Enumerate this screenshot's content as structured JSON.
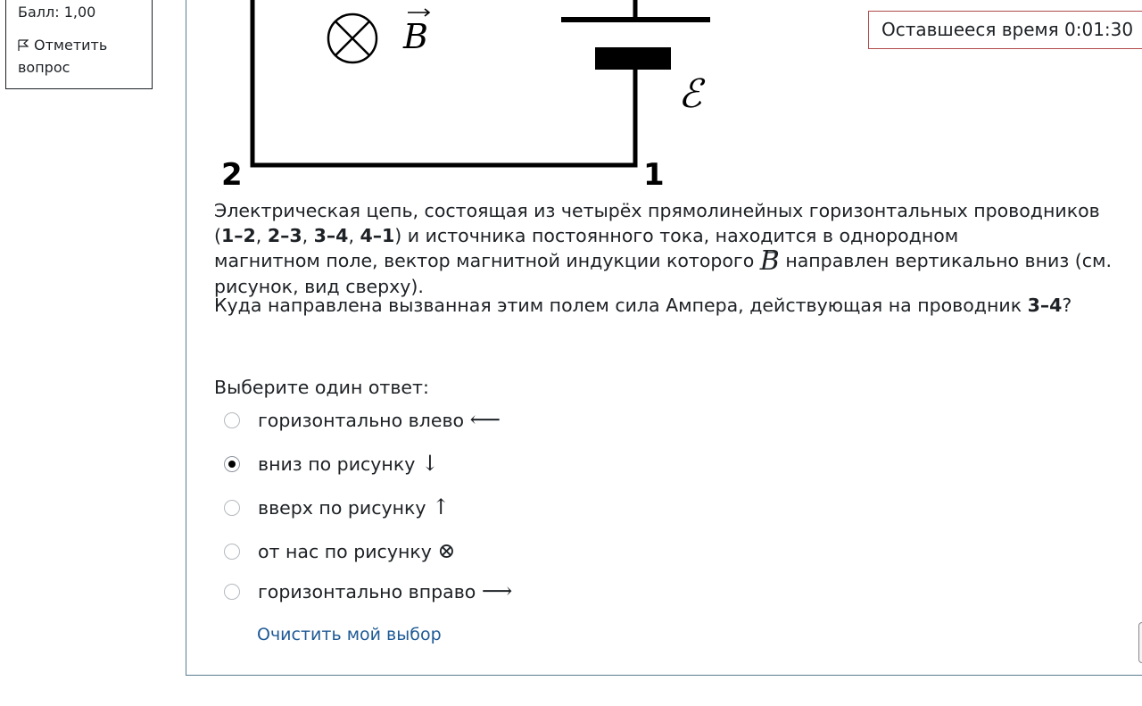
{
  "sidebar": {
    "score": "Балл: 1,00",
    "flag_label": "Отметить вопрос"
  },
  "timer": {
    "label": "Оставшееся время",
    "value": "0:01:30"
  },
  "figure": {
    "field_symbol": "B",
    "emf_symbol": "ℰ",
    "node_left": "2",
    "node_right": "1"
  },
  "question": {
    "p1_a": "Электрическая цепь, состоящая из четырёх прямолинейных горизонтальных проводников (",
    "seg1": "1–2",
    "sep1": ", ",
    "seg2": "2–3",
    "sep2": ", ",
    "seg3": "3–4",
    "sep3": ", ",
    "seg4": "4–1",
    "p1_b": ") и источника постоянного тока, находится в однородном",
    "p1_c": "магнитном поле, вектор магнитной индукции которого ",
    "p1_d": " направлен вертикально вниз (см. рисунок, вид сверху).",
    "p2_a": "Куда направлена вызванная этим полем сила Ампера, действующая на проводник ",
    "p2_bold": "3–4",
    "p2_b": "?"
  },
  "prompt": "Выберите один ответ:",
  "options": [
    {
      "text": "горизонтально влево",
      "symbol": "⟵",
      "selected": false
    },
    {
      "text": "вниз по рисунку",
      "symbol": "↓",
      "selected": true
    },
    {
      "text": "вверх по рисунку",
      "symbol": "↑",
      "selected": false
    },
    {
      "text": "от нас по рисунку",
      "symbol": "⊗",
      "selected": false
    },
    {
      "text": "горизонтально вправо",
      "symbol": "⟶",
      "selected": false
    }
  ],
  "clear_label": "Очистить мой выбор"
}
